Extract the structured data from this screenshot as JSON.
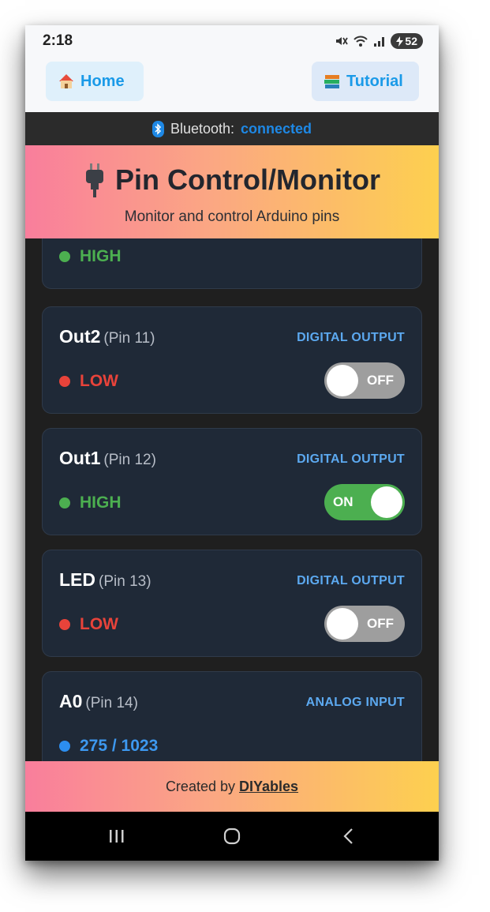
{
  "status_bar": {
    "time": "2:18",
    "battery": "52"
  },
  "nav": {
    "home_label": "Home",
    "tutorial_label": "Tutorial"
  },
  "bluetooth": {
    "label": "Bluetooth:",
    "state": "connected"
  },
  "header": {
    "title": "Pin Control/Monitor",
    "subtitle": "Monitor and control Arduino pins"
  },
  "pins": [
    {
      "name": "",
      "pin": "",
      "type": "",
      "state": "HIGH"
    },
    {
      "name": "Out2",
      "pin": "(Pin 11)",
      "type": "DIGITAL OUTPUT",
      "state": "LOW",
      "toggle": "OFF"
    },
    {
      "name": "Out1",
      "pin": "(Pin 12)",
      "type": "DIGITAL OUTPUT",
      "state": "HIGH",
      "toggle": "ON"
    },
    {
      "name": "LED",
      "pin": "(Pin 13)",
      "type": "DIGITAL OUTPUT",
      "state": "LOW",
      "toggle": "OFF"
    },
    {
      "name": "A0",
      "pin": "(Pin 14)",
      "type": "ANALOG INPUT",
      "state": "275 / 1023"
    }
  ],
  "footer": {
    "prefix": "Created by",
    "brand": "DIYables"
  },
  "colors": {
    "high": "#4caf50",
    "low": "#e8433a",
    "analog": "#2c8ef0",
    "accent": "#1e88e5",
    "card_bg": "#1f2937"
  }
}
